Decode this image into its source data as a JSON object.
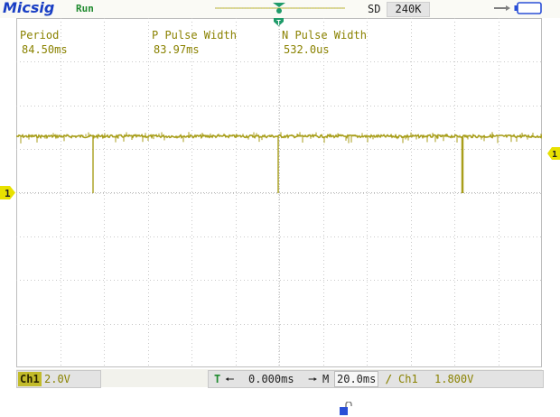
{
  "brand": "Micsig",
  "status": "Run",
  "acq_mode": "SD",
  "sample_depth": "240K",
  "measurements": [
    {
      "label": "Period",
      "value": "84.50ms"
    },
    {
      "label": "P Pulse Width",
      "value": "83.97ms"
    },
    {
      "label": "N Pulse Width",
      "value": "532.0us"
    }
  ],
  "channel": {
    "tag": "Ch1",
    "volts_div": "2.0V",
    "marker": "1"
  },
  "timebase": {
    "trigger_label": "T",
    "offset": "0.000ms",
    "m_label": "M",
    "scale": "20.0ms",
    "trig_source": "Ch1",
    "trig_level": "1.800V"
  },
  "colors": {
    "trace": "#a89e1a",
    "grid": "#c9c9c9",
    "brand": "#1a3fc4",
    "run": "#1f8a2e",
    "trigger": "#1f9b6a"
  },
  "icons": [
    "usb-icon",
    "battery-icon",
    "lock-icon",
    "arrow-left-icon",
    "arrow-right-icon",
    "rising-edge-icon"
  ]
}
